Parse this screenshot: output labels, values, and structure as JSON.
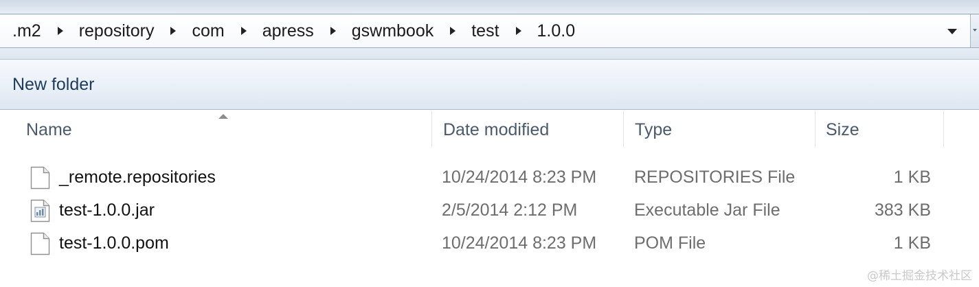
{
  "address_bar": {
    "crumbs": [
      ".m2",
      "repository",
      "com",
      "apress",
      "gswmbook",
      "test",
      "1.0.0"
    ]
  },
  "toolbar": {
    "new_folder_label": "New folder"
  },
  "file_list": {
    "columns": {
      "name": "Name",
      "date_modified": "Date modified",
      "type": "Type",
      "size": "Size"
    },
    "sorted_by": "Name",
    "sort_direction": "ascending",
    "rows": [
      {
        "name": "_remote.repositories",
        "date_modified": "10/24/2014 8:23 PM",
        "type": "REPOSITORIES File",
        "size": "1 KB",
        "icon": "generic-file-icon"
      },
      {
        "name": "test-1.0.0.jar",
        "date_modified": "2/5/2014 2:12 PM",
        "type": "Executable Jar File",
        "size": "383 KB",
        "icon": "jar-file-icon"
      },
      {
        "name": "test-1.0.0.pom",
        "date_modified": "10/24/2014 8:23 PM",
        "type": "POM File",
        "size": "1 KB",
        "icon": "generic-file-icon"
      }
    ]
  },
  "watermark": "@稀土掘金技术社区"
}
